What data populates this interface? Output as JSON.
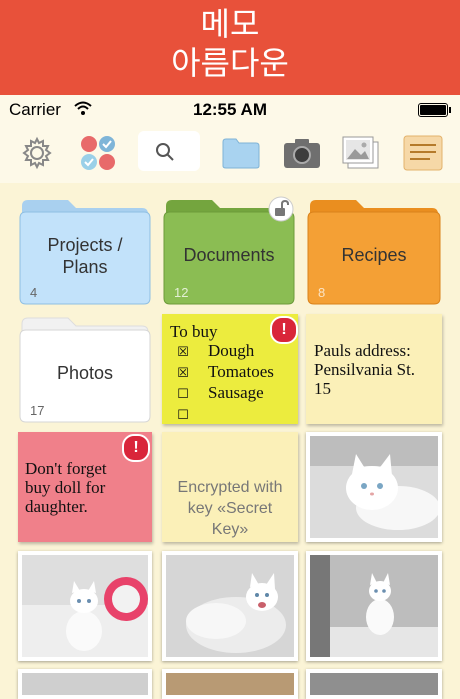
{
  "banner": {
    "line1": "메모",
    "line2": "아름다운"
  },
  "status": {
    "carrier": "Carrier",
    "time": "12:55 AM"
  },
  "toolbar": {
    "buttons": [
      "settings-icon",
      "colors-icon",
      "search-icon",
      "folder-icon",
      "camera-icon",
      "photos-icon",
      "list-icon"
    ]
  },
  "folders": [
    {
      "label": "Projects /\nPlans",
      "count": "4",
      "color": "#bfe0f7"
    },
    {
      "label": "Documents",
      "count": "12",
      "color": "#86b54e"
    },
    {
      "label": "Recipes",
      "count": "8",
      "color": "#f29b2c"
    },
    {
      "label": "Photos",
      "count": "17",
      "color": "#ffffff"
    }
  ],
  "notes": {
    "todo": {
      "title": "To buy",
      "items": [
        {
          "text": "Dough",
          "checked": true
        },
        {
          "text": "Tomatoes",
          "checked": true
        },
        {
          "text": "Sausage",
          "checked": false
        },
        {
          "text": "",
          "checked": false
        }
      ],
      "color": "#ecec3e"
    },
    "address": {
      "text": "Pauls address:\nPensilvania St.\n15",
      "color": "#fbf0b8"
    },
    "reminder": {
      "text": "Don't forget\nbuy doll for\ndaughter.",
      "color": "#f0808a"
    },
    "encrypted": {
      "text": "Encrypted with\nkey «Secret\nKey»",
      "color": "#fbf0b8"
    }
  },
  "alert_mark": "!"
}
